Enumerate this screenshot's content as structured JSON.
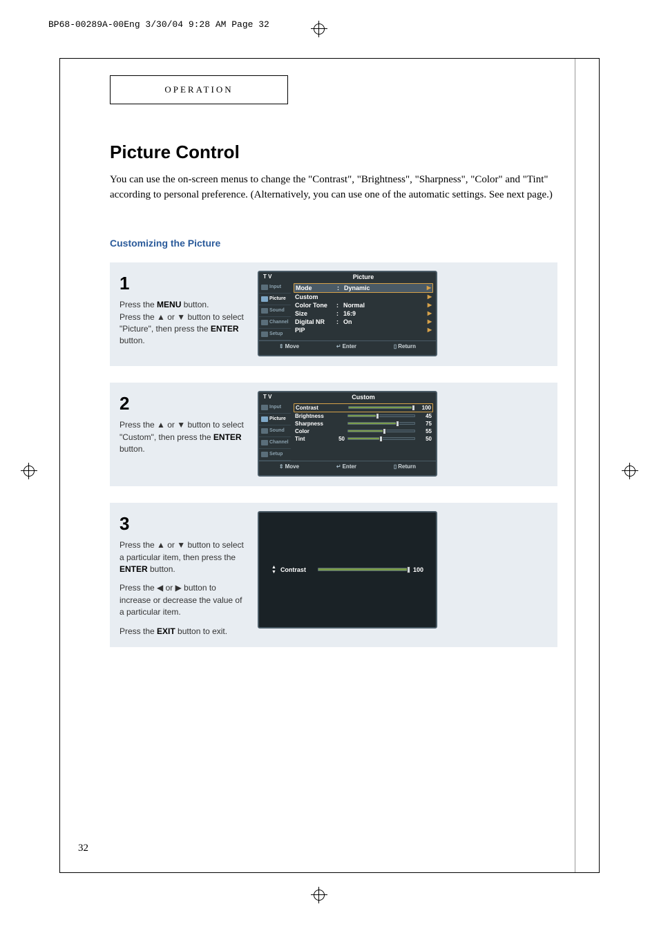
{
  "print_header": "BP68-00289A-00Eng  3/30/04  9:28 AM  Page 32",
  "section_label": "OPERATION",
  "title": "Picture Control",
  "intro": "You can use the on-screen menus to change the \"Contrast\", \"Brightness\", \"Sharpness\", \"Color\" and \"Tint\" according to personal preference. (Alternatively, you can use one of the automatic settings. See next page.)",
  "subheading": "Customizing the Picture",
  "steps": {
    "s1": {
      "num": "1",
      "p1a": "Press the ",
      "p1b": "MENU",
      "p1c": " button.",
      "p2a": "Press the ▲ or ▼ button to select \"Picture\", then press the ",
      "p2b": "ENTER",
      "p2c": " button."
    },
    "s2": {
      "num": "2",
      "p1a": "Press the ▲ or ▼ button to select \"Custom\", then press the ",
      "p1b": "ENTER",
      "p1c": " button."
    },
    "s3": {
      "num": "3",
      "p1a": "Press the ▲ or ▼ button to select a particular item, then press the ",
      "p1b": "ENTER",
      "p1c": " button.",
      "p2": "Press the ◀ or ▶ button to increase or decrease the value of a particular item.",
      "p3a": "Press the ",
      "p3b": "EXIT",
      "p3c": " button to exit."
    }
  },
  "osd1": {
    "tv": "T V",
    "title": "Picture",
    "sidebar": [
      "Input",
      "Picture",
      "Sound",
      "Channel",
      "Setup"
    ],
    "rows": [
      {
        "lbl": "Mode",
        "val": "Dynamic",
        "sel": true,
        "arrow": true
      },
      {
        "lbl": "Custom",
        "val": "",
        "arrow": true
      },
      {
        "lbl": "Color Tone",
        "val": "Normal",
        "arrow": true
      },
      {
        "lbl": "Size",
        "val": "16:9",
        "arrow": true
      },
      {
        "lbl": "Digital NR",
        "val": "On",
        "arrow": true
      },
      {
        "lbl": "PIP",
        "val": "",
        "arrow": true
      }
    ],
    "footer": {
      "move": "Move",
      "enter": "Enter",
      "return": "Return"
    }
  },
  "osd2": {
    "tv": "T V",
    "title": "Custom",
    "sidebar": [
      "Input",
      "Picture",
      "Sound",
      "Channel",
      "Setup"
    ],
    "sliders": [
      {
        "lbl": "Contrast",
        "val": 100,
        "pct": 100,
        "sel": true
      },
      {
        "lbl": "Brightness",
        "val": 45,
        "pct": 45
      },
      {
        "lbl": "Sharpness",
        "val": 75,
        "pct": 75
      },
      {
        "lbl": "Color",
        "val": 55,
        "pct": 55
      },
      {
        "lbl": "Tint",
        "mid": "50",
        "val": 50,
        "pct": 50
      }
    ],
    "footer": {
      "move": "Move",
      "enter": "Enter",
      "return": "Return"
    }
  },
  "osd3": {
    "label": "Contrast",
    "value": "100"
  },
  "page_number": "32"
}
